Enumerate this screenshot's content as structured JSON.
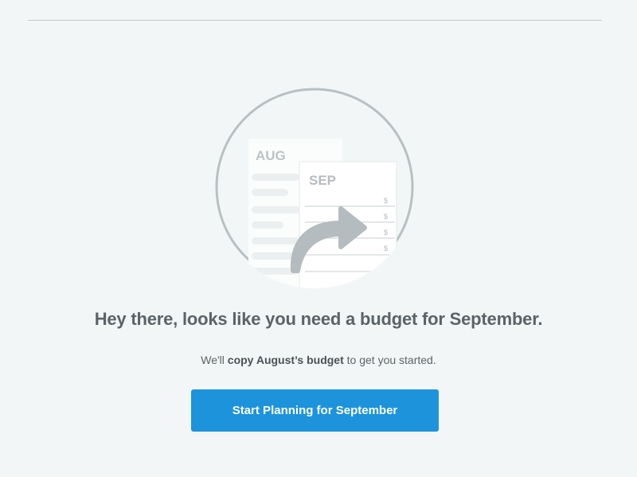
{
  "illustration": {
    "from_month": "AUG",
    "to_month": "SEP",
    "currency_symbol": "$",
    "icon": "copy-budget-arrow-icon"
  },
  "headline": "Hey there, looks like you need a budget for September.",
  "subtext": {
    "prefix": "We'll ",
    "emphasis": "copy August’s budget",
    "suffix": " to get you started."
  },
  "cta": {
    "label": "Start Planning for September"
  },
  "colors": {
    "background": "#f3f6f7",
    "primary_button": "#1d93db",
    "text": "#5c6366",
    "illustration_gray": "#b4bcbf"
  }
}
